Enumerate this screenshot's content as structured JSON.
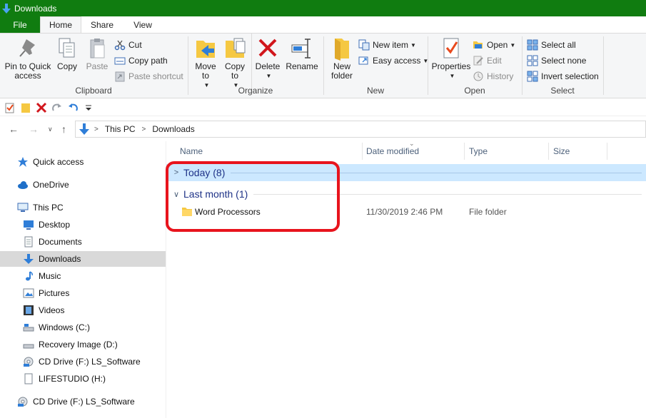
{
  "window": {
    "title": "Downloads"
  },
  "tabs": {
    "file": "File",
    "home": "Home",
    "share": "Share",
    "view": "View"
  },
  "ribbon": {
    "clipboard": {
      "label": "Clipboard",
      "pin": "Pin to Quick access",
      "copy": "Copy",
      "paste": "Paste",
      "cut": "Cut",
      "copy_path": "Copy path",
      "paste_shortcut": "Paste shortcut"
    },
    "organize": {
      "label": "Organize",
      "move_to": "Move to",
      "copy_to": "Copy to",
      "delete": "Delete",
      "rename": "Rename"
    },
    "new": {
      "label": "New",
      "new_folder": "New folder",
      "new_item": "New item",
      "easy_access": "Easy access"
    },
    "open": {
      "label": "Open",
      "properties": "Properties",
      "open": "Open",
      "edit": "Edit",
      "history": "History"
    },
    "select": {
      "label": "Select",
      "select_all": "Select all",
      "select_none": "Select none",
      "invert": "Invert selection"
    }
  },
  "address": {
    "crumbs": [
      "This PC",
      "Downloads"
    ]
  },
  "nav": {
    "items": [
      {
        "label": "Quick access"
      },
      {
        "label": "OneDrive"
      },
      {
        "label": "This PC"
      },
      {
        "label": "Desktop"
      },
      {
        "label": "Documents"
      },
      {
        "label": "Downloads"
      },
      {
        "label": "Music"
      },
      {
        "label": "Pictures"
      },
      {
        "label": "Videos"
      },
      {
        "label": "Windows (C:)"
      },
      {
        "label": "Recovery Image (D:)"
      },
      {
        "label": "CD Drive (F:) LS_Software"
      },
      {
        "label": "LIFESTUDIO (H:)"
      },
      {
        "label": "CD Drive (F:) LS_Software"
      }
    ]
  },
  "columns": {
    "name": "Name",
    "date": "Date modified",
    "type": "Type",
    "size": "Size"
  },
  "groups": [
    {
      "title": "Today (8)"
    },
    {
      "title": "Last month (1)"
    }
  ],
  "files": [
    {
      "name": "Word Processors",
      "date": "11/30/2019 2:46 PM",
      "type": "File folder"
    }
  ],
  "colors": {
    "accent": "#107c10",
    "selection": "#cce8ff",
    "highlight": "#e8141d"
  }
}
